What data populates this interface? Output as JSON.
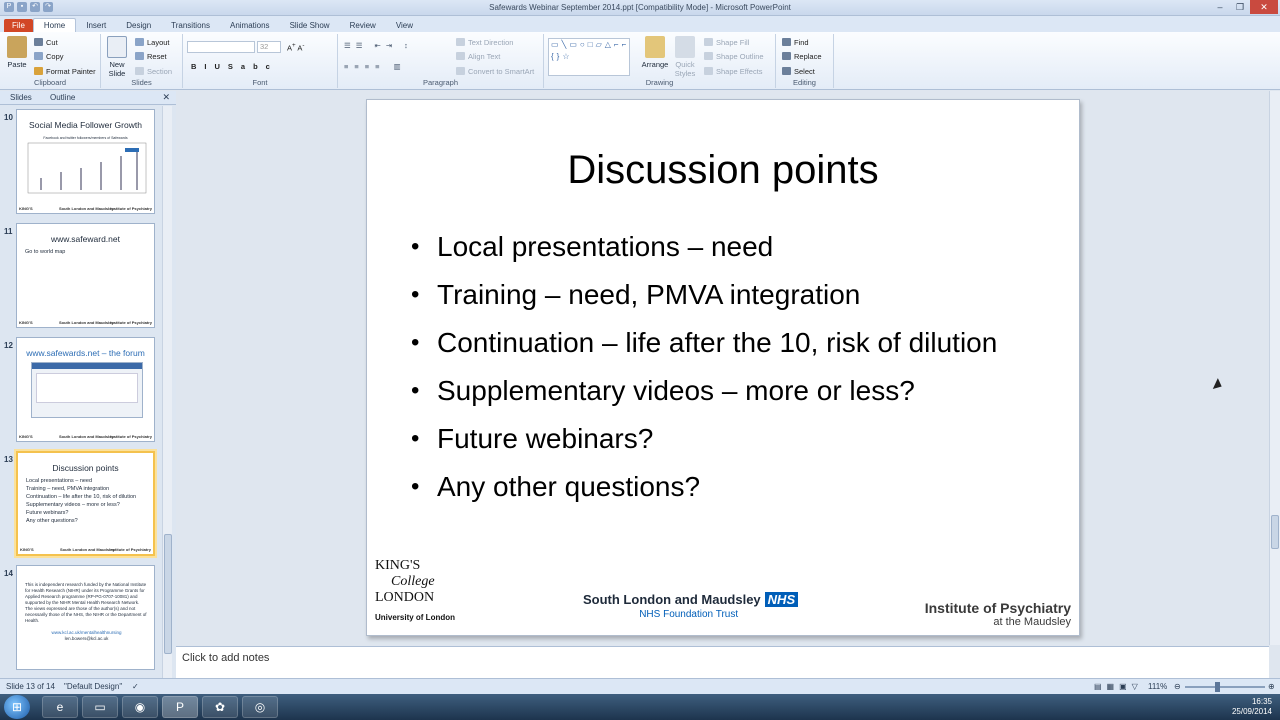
{
  "window": {
    "title": "Safewards Webinar September 2014.ppt [Compatibility Mode] - Microsoft PowerPoint"
  },
  "tabs": [
    "File",
    "Home",
    "Insert",
    "Design",
    "Transitions",
    "Animations",
    "Slide Show",
    "Review",
    "View"
  ],
  "ribbon": {
    "clipboard": {
      "label": "Clipboard",
      "paste": "Paste",
      "cut": "Cut",
      "copy": "Copy",
      "format_painter": "Format Painter"
    },
    "slides": {
      "label": "Slides",
      "new_slide": "New Slide",
      "layout": "Layout",
      "reset": "Reset",
      "section": "Section"
    },
    "font": {
      "label": "Font",
      "size": "32"
    },
    "paragraph": {
      "label": "Paragraph",
      "text_direction": "Text Direction",
      "align_text": "Align Text",
      "smartart": "Convert to SmartArt"
    },
    "drawing": {
      "label": "Drawing",
      "arrange": "Arrange",
      "quick_styles": "Quick Styles",
      "shape_fill": "Shape Fill",
      "shape_outline": "Shape Outline",
      "shape_effects": "Shape Effects"
    },
    "editing": {
      "label": "Editing",
      "find": "Find",
      "replace": "Replace",
      "select": "Select"
    }
  },
  "panel_tabs": {
    "slides": "Slides",
    "outline": "Outline"
  },
  "thumbnails": [
    {
      "num": "10",
      "title": "Social Media Follower Growth",
      "subtitle": "Facebook and twitter followers/members of Safewards",
      "bullets": []
    },
    {
      "num": "11",
      "title": "www.safeward.net",
      "bullets": [
        "Go to world map"
      ]
    },
    {
      "num": "12",
      "title": "www.safewards.net – the forum",
      "bullets": []
    },
    {
      "num": "13",
      "title": "Discussion points",
      "bullets": [
        "Local presentations – need",
        "Training – need, PMVA integration",
        "Continuation – life after the 10, risk of dilution",
        "Supplementary videos – more or less?",
        "Future webinars?",
        "Any other questions?"
      ]
    },
    {
      "num": "14",
      "title": "",
      "bullets": [
        "This is independent research funded by the National Institute for Health Research (NIHR) under its Programme Grants for Applied Research programme (RP-PG-0707-10081) and supported by the NIHR Mental Health Research Network. The views expressed are those of the author(s) and not necessarily those of the NHS, the NIHR or the Department of Health.",
        "www.kcl.ac.uk/mentalhealthnursing",
        "len.bowers@kcl.ac.uk"
      ]
    }
  ],
  "slide": {
    "title": "Discussion points",
    "bullets": [
      "Local presentations – need",
      "Training – need, PMVA integration",
      "Continuation – life after the 10, risk of dilution",
      "Supplementary videos – more or less?",
      "Future webinars?",
      "Any other questions?"
    ],
    "logos": {
      "kings_line1": "KING'S",
      "kings_line2": "College",
      "kings_line3": "LONDON",
      "kings_sub": "University of London",
      "slam": "South London and Maudsley",
      "nhs": "NHS",
      "slam_sub": "NHS Foundation Trust",
      "iop": "Institute of Psychiatry",
      "iop_sub": "at the Maudsley"
    }
  },
  "notes": {
    "placeholder": "Click to add notes"
  },
  "status": {
    "slide": "Slide 13 of 14",
    "theme": "\"Default Design\"",
    "zoom": "111%"
  },
  "tray": {
    "time": "16:35",
    "date": "25/09/2014"
  }
}
